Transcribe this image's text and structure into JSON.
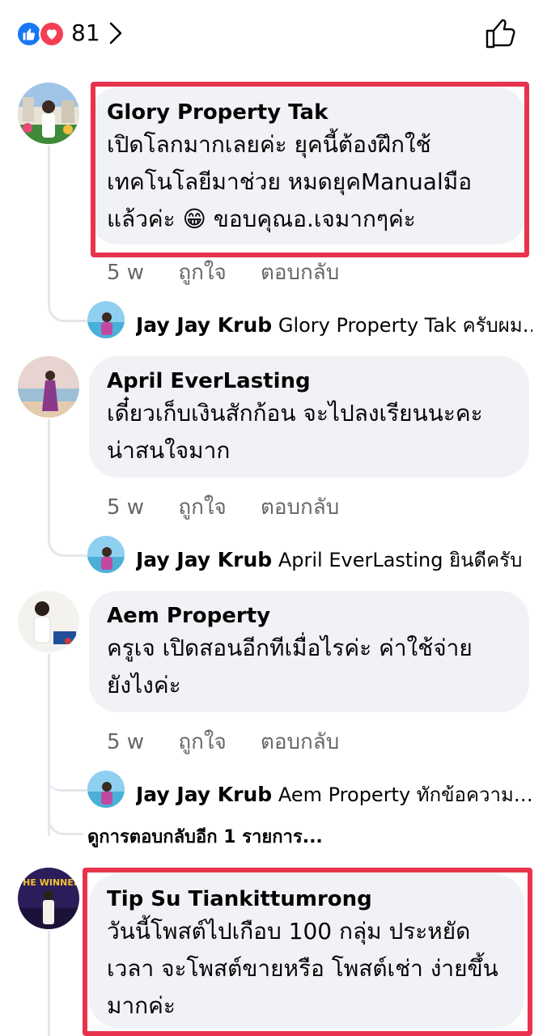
{
  "reactions": {
    "count": "81",
    "icons": [
      "like-icon",
      "love-icon"
    ],
    "colors": {
      "like": "#1877f2",
      "love": "#f33e58"
    }
  },
  "comments": [
    {
      "author": "Glory Property Tak",
      "lines": [
        "เปิดโลกมากเลยค่ะ ยุคนี้ต้องฝึกใช้",
        "เทคโนโลยีมาช่วย หมดยุคManualมือ",
        "แล้วค่ะ 😁 ขอบคุณอ.เจมากๆค่ะ"
      ],
      "time": "5 w",
      "like_label": "ถูกใจ",
      "reply_label": "ตอบกลับ",
      "highlighted": true,
      "reply": {
        "author": "Jay Jay Krub",
        "text": "Glory Property Tak ครับผม…"
      }
    },
    {
      "author": "April EverLasting",
      "lines": [
        "เดี๋ยวเก็บเงินสักก้อน จะไปลงเรียนนะคะ",
        "น่าสนใจมาก"
      ],
      "time": "5 w",
      "like_label": "ถูกใจ",
      "reply_label": "ตอบกลับ",
      "highlighted": false,
      "reply": {
        "author": "Jay Jay Krub",
        "text": "April EverLasting ยินดีครับ"
      }
    },
    {
      "author": "Aem Property",
      "lines": [
        "ครูเจ เปิดสอนอีกทีเมื่อไรค่ะ  ค่าใช้จ่าย",
        "ยังไงค่ะ"
      ],
      "time": "5 w",
      "like_label": "ถูกใจ",
      "reply_label": "ตอบกลับ",
      "highlighted": false,
      "reply": {
        "author": "Jay Jay Krub",
        "text": "Aem Property ทักข้อความ…"
      },
      "more_replies": "ดูการตอบกลับอีก 1 รายการ..."
    },
    {
      "author": "Tip Su Tiankittumrong",
      "lines": [
        "วันนี้โพสต์ไปเกือบ 100 กลุ่ม ประหยัด",
        "เวลา จะโพสต์ขายหรือ โพสต์เช่า ง่ายขึ้น",
        "มากค่ะ"
      ],
      "highlighted": true,
      "avatar_banner": "THE WINNER"
    }
  ]
}
